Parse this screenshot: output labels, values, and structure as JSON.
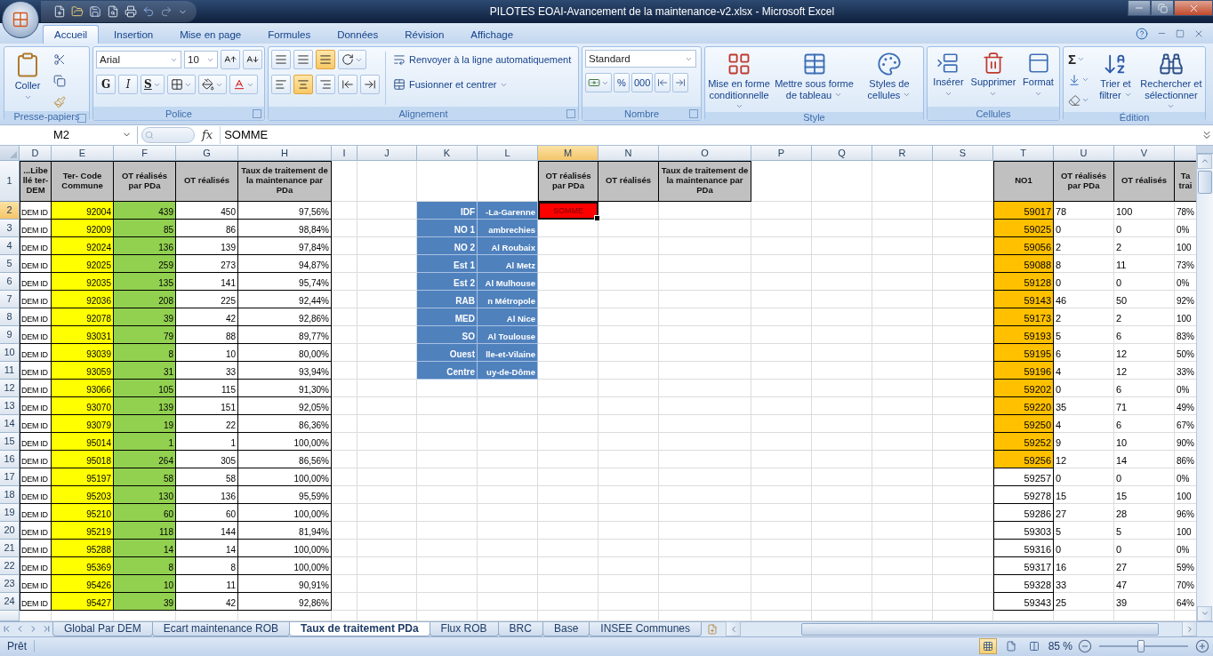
{
  "title_bar": {
    "title": "PILOTES EOAI-Avancement de la maintenance-v2.xlsx - Microsoft Excel"
  },
  "ribbon_tabs": [
    {
      "label": "Accueil",
      "selected": true
    },
    {
      "label": "Insertion",
      "selected": false
    },
    {
      "label": "Mise en page",
      "selected": false
    },
    {
      "label": "Formules",
      "selected": false
    },
    {
      "label": "Données",
      "selected": false
    },
    {
      "label": "Révision",
      "selected": false
    },
    {
      "label": "Affichage",
      "selected": false
    }
  ],
  "ribbon": {
    "clipboard": {
      "group": "Presse-papiers",
      "paste": "Coller"
    },
    "font": {
      "group": "Police",
      "font_name": "Arial",
      "font_size": "10",
      "bold": "G",
      "italic": "I",
      "underline": "S"
    },
    "alignment": {
      "group": "Alignement",
      "vertical": [
        {
          "selected": false
        },
        {
          "selected": false
        },
        {
          "selected": true
        }
      ],
      "horizontal": [
        {
          "selected": false
        },
        {
          "selected": true
        },
        {
          "selected": false
        }
      ],
      "wrap": "Renvoyer à la ligne automatiquement",
      "merge": "Fusionner et centrer"
    },
    "number": {
      "group": "Nombre",
      "format": "Standard",
      "percent": "%",
      "thousands": "000"
    },
    "style": {
      "group": "Style",
      "buttons": [
        "Mise en forme conditionnelle",
        "Mettre sous forme de tableau",
        "Styles de cellules"
      ]
    },
    "cells": {
      "group": "Cellules",
      "buttons": [
        "Insérer",
        "Supprimer",
        "Format"
      ]
    },
    "editing": {
      "group": "Édition",
      "sum": "Σ",
      "buttons": [
        "Trier et filtrer",
        "Rechercher et sélectionner"
      ]
    }
  },
  "formula_bar": {
    "name_box": "M2",
    "fx": "fx",
    "formula": "SOMME"
  },
  "sheet": {
    "column_headers": [
      {
        "label": "D",
        "selected": false
      },
      {
        "label": "E",
        "selected": false
      },
      {
        "label": "F",
        "selected": false
      },
      {
        "label": "G",
        "selected": false
      },
      {
        "label": "H",
        "selected": false
      },
      {
        "label": "I",
        "selected": false
      },
      {
        "label": "J",
        "selected": false
      },
      {
        "label": "K",
        "selected": false
      },
      {
        "label": "L",
        "selected": false
      },
      {
        "label": "M",
        "selected": true
      },
      {
        "label": "N",
        "selected": false
      },
      {
        "label": "O",
        "selected": false
      },
      {
        "label": "P",
        "selected": false
      },
      {
        "label": "Q",
        "selected": false
      },
      {
        "label": "R",
        "selected": false
      },
      {
        "label": "S",
        "selected": false
      },
      {
        "label": "T",
        "selected": false
      },
      {
        "label": "U",
        "selected": false
      },
      {
        "label": "V",
        "selected": false
      }
    ],
    "row_headers": [
      {
        "label": "1",
        "selected": false
      },
      {
        "label": "2",
        "selected": true
      },
      {
        "label": "3",
        "selected": false
      },
      {
        "label": "4",
        "selected": false
      },
      {
        "label": "5",
        "selected": false
      },
      {
        "label": "6",
        "selected": false
      },
      {
        "label": "7",
        "selected": false
      },
      {
        "label": "8",
        "selected": false
      },
      {
        "label": "9",
        "selected": false
      },
      {
        "label": "10",
        "selected": false
      },
      {
        "label": "11",
        "selected": false
      },
      {
        "label": "12",
        "selected": false
      },
      {
        "label": "13",
        "selected": false
      },
      {
        "label": "14",
        "selected": false
      },
      {
        "label": "15",
        "selected": false
      },
      {
        "label": "16",
        "selected": false
      },
      {
        "label": "17",
        "selected": false
      },
      {
        "label": "18",
        "selected": false
      },
      {
        "label": "19",
        "selected": false
      },
      {
        "label": "20",
        "selected": false
      },
      {
        "label": "21",
        "selected": false
      },
      {
        "label": "22",
        "selected": false
      },
      {
        "label": "23",
        "selected": false
      },
      {
        "label": "24",
        "selected": false
      }
    ],
    "left_table": {
      "headers": [
        "...Libe llé ter- DEM",
        "Ter- Code Commune",
        "OT réalisés par PDa",
        "OT réalisés",
        "Taux de traitement de la maintenance par PDa"
      ],
      "rows": [
        {
          "dem": "DEM ID",
          "code": "92004",
          "pda": "439",
          "total": "450",
          "rate": "97,56%"
        },
        {
          "dem": "DEM ID",
          "code": "92009",
          "pda": "85",
          "total": "86",
          "rate": "98,84%"
        },
        {
          "dem": "DEM ID",
          "code": "92024",
          "pda": "136",
          "total": "139",
          "rate": "97,84%"
        },
        {
          "dem": "DEM ID",
          "code": "92025",
          "pda": "259",
          "total": "273",
          "rate": "94,87%"
        },
        {
          "dem": "DEM ID",
          "code": "92035",
          "pda": "135",
          "total": "141",
          "rate": "95,74%"
        },
        {
          "dem": "DEM ID",
          "code": "92036",
          "pda": "208",
          "total": "225",
          "rate": "92,44%"
        },
        {
          "dem": "DEM ID",
          "code": "92078",
          "pda": "39",
          "total": "42",
          "rate": "92,86%"
        },
        {
          "dem": "DEM ID",
          "code": "93031",
          "pda": "79",
          "total": "88",
          "rate": "89,77%"
        },
        {
          "dem": "DEM ID",
          "code": "93039",
          "pda": "8",
          "total": "10",
          "rate": "80,00%"
        },
        {
          "dem": "DEM ID",
          "code": "93059",
          "pda": "31",
          "total": "33",
          "rate": "93,94%"
        },
        {
          "dem": "DEM ID",
          "code": "93066",
          "pda": "105",
          "total": "115",
          "rate": "91,30%"
        },
        {
          "dem": "DEM ID",
          "code": "93070",
          "pda": "139",
          "total": "151",
          "rate": "92,05%"
        },
        {
          "dem": "DEM ID",
          "code": "93079",
          "pda": "19",
          "total": "22",
          "rate": "86,36%"
        },
        {
          "dem": "DEM ID",
          "code": "95014",
          "pda": "1",
          "total": "1",
          "rate": "100,00%"
        },
        {
          "dem": "DEM ID",
          "code": "95018",
          "pda": "264",
          "total": "305",
          "rate": "86,56%"
        },
        {
          "dem": "DEM ID",
          "code": "95197",
          "pda": "58",
          "total": "58",
          "rate": "100,00%"
        },
        {
          "dem": "DEM ID",
          "code": "95203",
          "pda": "130",
          "total": "136",
          "rate": "95,59%"
        },
        {
          "dem": "DEM ID",
          "code": "95210",
          "pda": "60",
          "total": "60",
          "rate": "100,00%"
        },
        {
          "dem": "DEM ID",
          "code": "95219",
          "pda": "118",
          "total": "144",
          "rate": "81,94%"
        },
        {
          "dem": "DEM ID",
          "code": "95288",
          "pda": "14",
          "total": "14",
          "rate": "100,00%"
        },
        {
          "dem": "DEM ID",
          "code": "95369",
          "pda": "8",
          "total": "8",
          "rate": "100,00%"
        },
        {
          "dem": "DEM ID",
          "code": "95426",
          "pda": "10",
          "total": "11",
          "rate": "90,91%"
        },
        {
          "dem": "DEM ID",
          "code": "95427",
          "pda": "39",
          "total": "42",
          "rate": "92,86%"
        }
      ]
    },
    "region_table": [
      {
        "region": "IDF",
        "site": "-La-Garenne"
      },
      {
        "region": "NO 1",
        "site": "ambrechies"
      },
      {
        "region": "NO 2",
        "site": "Al Roubaix"
      },
      {
        "region": "Est 1",
        "site": "Al Metz"
      },
      {
        "region": "Est 2",
        "site": "Al Mulhouse"
      },
      {
        "region": "RAB",
        "site": "n Métropole"
      },
      {
        "region": "MED",
        "site": "Al Nice"
      },
      {
        "region": "SO",
        "site": "Al Toulouse"
      },
      {
        "region": "Ouest",
        "site": "lle-et-Vilaine"
      },
      {
        "region": "Centre",
        "site": "uy-de-Dôme"
      }
    ],
    "summary": {
      "headers": [
        "OT réalisés par PDa",
        "OT réalisés",
        "Taux de traitement de la maintenance par PDa"
      ],
      "active_cell": "SOMME"
    },
    "right_table": {
      "headers": [
        "NO1",
        "OT réalisés par PDa",
        "OT réalisés",
        "Ta trai"
      ],
      "rows": [
        {
          "code": "59017",
          "highlighted": true,
          "pda": "78",
          "total": "100",
          "rate": "78%"
        },
        {
          "code": "59025",
          "highlighted": true,
          "pda": "0",
          "total": "0",
          "rate": "0%"
        },
        {
          "code": "59056",
          "highlighted": true,
          "pda": "2",
          "total": "2",
          "rate": "100"
        },
        {
          "code": "59088",
          "highlighted": true,
          "pda": "8",
          "total": "11",
          "rate": "73%"
        },
        {
          "code": "59128",
          "highlighted": true,
          "pda": "0",
          "total": "0",
          "rate": "0%"
        },
        {
          "code": "59143",
          "highlighted": true,
          "pda": "46",
          "total": "50",
          "rate": "92%"
        },
        {
          "code": "59173",
          "highlighted": true,
          "pda": "2",
          "total": "2",
          "rate": "100"
        },
        {
          "code": "59193",
          "highlighted": true,
          "pda": "5",
          "total": "6",
          "rate": "83%"
        },
        {
          "code": "59195",
          "highlighted": true,
          "pda": "6",
          "total": "12",
          "rate": "50%"
        },
        {
          "code": "59196",
          "highlighted": true,
          "pda": "4",
          "total": "12",
          "rate": "33%"
        },
        {
          "code": "59202",
          "highlighted": true,
          "pda": "0",
          "total": "6",
          "rate": "0%"
        },
        {
          "code": "59220",
          "highlighted": true,
          "pda": "35",
          "total": "71",
          "rate": "49%"
        },
        {
          "code": "59250",
          "highlighted": true,
          "pda": "4",
          "total": "6",
          "rate": "67%"
        },
        {
          "code": "59252",
          "highlighted": true,
          "pda": "9",
          "total": "10",
          "rate": "90%"
        },
        {
          "code": "59256",
          "highlighted": true,
          "pda": "12",
          "total": "14",
          "rate": "86%"
        },
        {
          "code": "59257",
          "highlighted": false,
          "pda": "0",
          "total": "0",
          "rate": "0%"
        },
        {
          "code": "59278",
          "highlighted": false,
          "pda": "15",
          "total": "15",
          "rate": "100"
        },
        {
          "code": "59286",
          "highlighted": false,
          "pda": "27",
          "total": "28",
          "rate": "96%"
        },
        {
          "code": "59303",
          "highlighted": false,
          "pda": "5",
          "total": "5",
          "rate": "100"
        },
        {
          "code": "59316",
          "highlighted": false,
          "pda": "0",
          "total": "0",
          "rate": "0%"
        },
        {
          "code": "59317",
          "highlighted": false,
          "pda": "16",
          "total": "27",
          "rate": "59%"
        },
        {
          "code": "59328",
          "highlighted": false,
          "pda": "33",
          "total": "47",
          "rate": "70%"
        },
        {
          "code": "59343",
          "highlighted": false,
          "pda": "25",
          "total": "39",
          "rate": "64%"
        }
      ]
    }
  },
  "sheet_tabs": [
    {
      "label": "Global Par DEM",
      "selected": false
    },
    {
      "label": "Ecart maintenance ROB",
      "selected": false
    },
    {
      "label": "Taux de traitement PDa",
      "selected": true
    },
    {
      "label": "Flux ROB",
      "selected": false
    },
    {
      "label": "BRC",
      "selected": false
    },
    {
      "label": "Base",
      "selected": false
    },
    {
      "label": "INSEE Communes",
      "selected": false
    }
  ],
  "status_bar": {
    "status": "Prêt",
    "zoom": "85 %",
    "zoom_slider": {
      "level": 0.47
    }
  }
}
